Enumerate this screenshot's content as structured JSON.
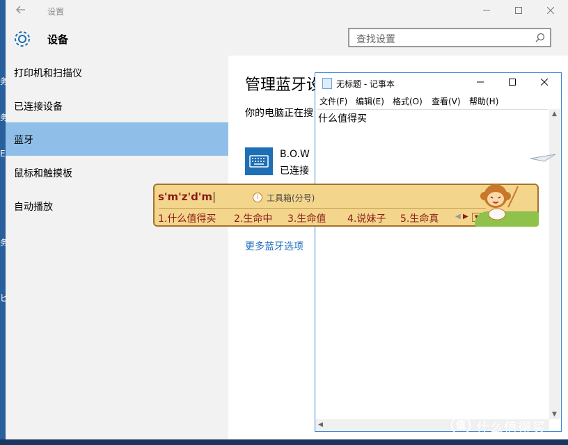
{
  "desktop": {
    "edge_chars": [
      "务",
      "务",
      "E",
      "务",
      "匕"
    ]
  },
  "settings": {
    "window_title": "设置",
    "page_heading": "设备",
    "search_placeholder": "查找设置",
    "sidebar_items": [
      {
        "label": "打印机和扫描仪",
        "active": false
      },
      {
        "label": "已连接设备",
        "active": false
      },
      {
        "label": "蓝牙",
        "active": true
      },
      {
        "label": "鼠标和触摸板",
        "active": false
      },
      {
        "label": "自动播放",
        "active": false
      }
    ],
    "content": {
      "title": "管理蓝牙设",
      "description": "你的电脑正在搜",
      "device_name": "B.O.W",
      "device_status": "已连接",
      "more_link": "更多蓝牙选项"
    }
  },
  "notepad": {
    "title": "无标题 - 记事本",
    "menu": [
      "文件(F)",
      "编辑(E)",
      "格式(O)",
      "查看(V)",
      "帮助(H)"
    ],
    "text": "什么值得买"
  },
  "ime": {
    "composition": "s'm'z'd'm",
    "toolbox_label": "工具箱(分号)",
    "candidates": [
      "1.什么值得买",
      "2.生命中",
      "3.生命值",
      "4.说妹子",
      "5.生命真"
    ]
  },
  "watermark": {
    "logo": "值",
    "text": "什么值得买"
  },
  "colors": {
    "accent": "#1e6fb5",
    "sidebar_active": "#8fbfe8",
    "ime_bg": "#f3d58b",
    "ime_text": "#8b1a1a",
    "link": "#1f6fbf"
  }
}
